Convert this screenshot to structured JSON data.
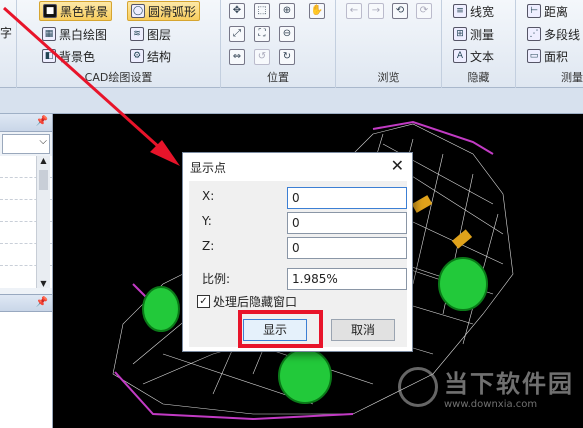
{
  "ribbon": {
    "cad_group": {
      "partial_label": "字",
      "black_bg": "黑色背景",
      "smooth_arc": "圆滑弧形",
      "bw_drawing": "黑白绘图",
      "layers": "图层",
      "bg_color": "背景色",
      "structure": "结构",
      "label": "CAD绘图设置"
    },
    "position_group": {
      "label": "位置"
    },
    "browse_group": {
      "label": "浏览"
    },
    "hide_group": {
      "line_width": "线宽",
      "measure": "测量",
      "text": "文本",
      "label": "隐藏"
    },
    "measure_group": {
      "distance": "距离",
      "polyline": "多段线",
      "area": "面积",
      "label": "测量"
    }
  },
  "dialog": {
    "title": "显示点",
    "close": "✕",
    "x_label": "X:",
    "x_value": "0",
    "y_label": "Y:",
    "y_value": "0",
    "z_label": "Z:",
    "z_value": "0",
    "scale_label": "比例:",
    "scale_value": "1.985%",
    "hide_checkbox_label": "处理后隐藏窗口",
    "hide_checked": true,
    "show_button": "显示",
    "cancel_button": "取消"
  },
  "watermark": {
    "main": "当下软件园",
    "url": "www.downxia.com"
  },
  "colors": {
    "highlight": "#e8142a",
    "arrow": "#e8142a",
    "accent": "#3c7fd4"
  }
}
